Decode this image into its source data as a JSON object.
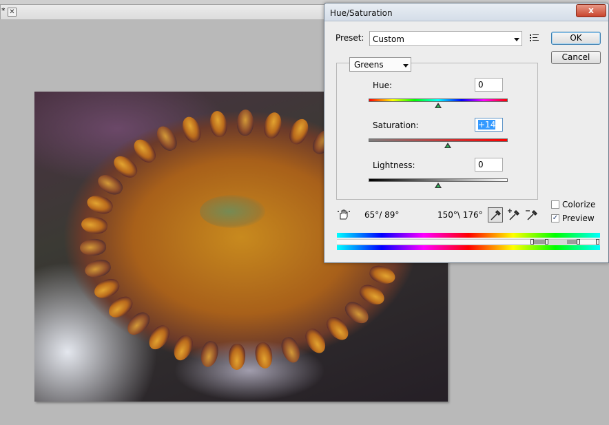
{
  "document": {
    "modified_marker": "*",
    "close_glyph": "✕"
  },
  "photo": {
    "description_icon": "image-canvas"
  },
  "dialog": {
    "title": "Hue/Saturation",
    "close_glyph": "x",
    "preset_label": "Preset:",
    "preset_value": "Custom",
    "ok_label": "OK",
    "cancel_label": "Cancel",
    "channel_value": "Greens",
    "hue_label": "Hue:",
    "hue_value": "0",
    "hue_level": 0,
    "saturation_label": "Saturation:",
    "saturation_value": "+14",
    "saturation_level": 14,
    "lightness_label": "Lightness:",
    "lightness_value": "0",
    "lightness_level": 0,
    "range_left": "65°/ 89°",
    "range_right": "150°\\ 176°",
    "colorize_label": "Colorize",
    "colorize_checked": false,
    "preview_label": "Preview",
    "preview_checked": true,
    "preview_check_glyph": "✓",
    "icons": {
      "targeted_adjustment": "hand-adjust-icon",
      "eyedropper": "eyedropper-icon",
      "eyedropper_add": "eyedropper-plus-icon",
      "eyedropper_subtract": "eyedropper-minus-icon",
      "preset_options": "list-options-icon"
    },
    "colors": {
      "ok_border": "#3c7fb1",
      "close_button": "#c8442d",
      "selection": "#3399ff",
      "slider_thumb": "#2fb25a"
    }
  }
}
